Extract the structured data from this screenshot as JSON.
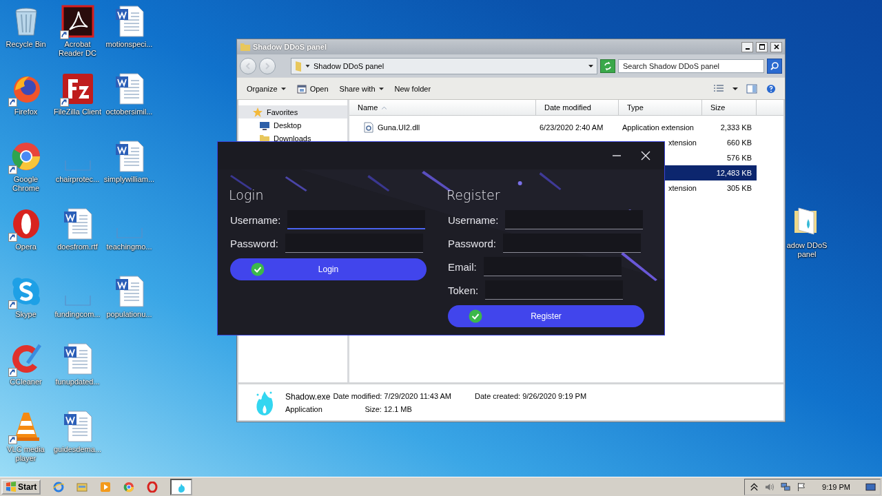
{
  "desktop": {
    "icon_columns": [
      [
        {
          "label": "Recycle Bin",
          "kind": "recycle",
          "shortcut": false
        },
        {
          "label": "Firefox",
          "kind": "firefox",
          "shortcut": true
        },
        {
          "label": "Google Chrome",
          "kind": "chrome",
          "shortcut": true
        },
        {
          "label": "Opera",
          "kind": "opera",
          "shortcut": true
        },
        {
          "label": "Skype",
          "kind": "skype",
          "shortcut": true
        },
        {
          "label": "CCleaner",
          "kind": "ccleaner",
          "shortcut": true
        },
        {
          "label": "VLC media player",
          "kind": "vlc",
          "shortcut": true
        }
      ],
      [
        {
          "label": "Acrobat Reader DC",
          "kind": "acrobat",
          "shortcut": true
        },
        {
          "label": "FileZilla Client",
          "kind": "filezilla",
          "shortcut": true
        },
        {
          "label": "chairprotec...",
          "kind": "blank",
          "shortcut": false
        },
        {
          "label": "doesfrom.rtf",
          "kind": "word",
          "shortcut": false
        },
        {
          "label": "fundingcom...",
          "kind": "blank",
          "shortcut": false
        },
        {
          "label": "funupdated...",
          "kind": "word",
          "shortcut": false
        },
        {
          "label": "guidesdema...",
          "kind": "word",
          "shortcut": false
        }
      ],
      [
        {
          "label": "motionspeci...",
          "kind": "word",
          "shortcut": false
        },
        {
          "label": "octobersimil...",
          "kind": "word",
          "shortcut": false
        },
        {
          "label": "simplywilliam...",
          "kind": "word",
          "shortcut": false
        },
        {
          "label": "teachingmo...",
          "kind": "blank",
          "shortcut": false
        },
        {
          "label": "populationu...",
          "kind": "word",
          "shortcut": false
        }
      ]
    ],
    "folder": {
      "label": "adow DDoS panel"
    }
  },
  "explorer": {
    "title": "Shadow DDoS panel",
    "address": "Shadow DDoS panel",
    "search_placeholder": "Search Shadow DDoS panel",
    "toolbar": [
      {
        "label": "Organize",
        "kind": "menu"
      },
      {
        "label": "Open",
        "kind": "open"
      },
      {
        "label": "Share with",
        "kind": "menu"
      },
      {
        "label": "New folder",
        "kind": "plain"
      }
    ],
    "nav": [
      {
        "label": "Favorites",
        "kind": "favorites",
        "selected": true
      },
      {
        "label": "Desktop",
        "kind": "desktop",
        "selected": false
      },
      {
        "label": "Downloads",
        "kind": "downloads",
        "selected": false
      }
    ],
    "columns": [
      {
        "label": "Name",
        "sorted": true
      },
      {
        "label": "Date modified",
        "sorted": false
      },
      {
        "label": "Type",
        "sorted": false
      },
      {
        "label": "Size",
        "sorted": false
      }
    ],
    "rows": [
      {
        "name": "Guna.UI2.dll",
        "date_modified": "6/23/2020 2:40 AM",
        "type": "Application extension",
        "size": "2,333 KB",
        "selected": false
      },
      {
        "type": "xtension",
        "size": "660 KB",
        "selected": false
      },
      {
        "size": "576 KB",
        "selected": false
      },
      {
        "size": "12,483 KB",
        "selected": true
      },
      {
        "type": "xtension",
        "size": "305 KB",
        "selected": false
      }
    ],
    "details": {
      "name": "Shadow.exe",
      "type": "Application",
      "date_modified": "Date modified: 7/29/2020 11:43 AM",
      "date_created": "Date created: 9/26/2020 9:19 PM",
      "size": "Size: 12.1 MB"
    }
  },
  "dialog": {
    "sections": [
      {
        "title": "Login",
        "fields": [
          {
            "label": "Username:",
            "focused": true
          },
          {
            "label": "Password:",
            "focused": false
          }
        ],
        "button": "Login"
      },
      {
        "title": "Register",
        "fields": [
          {
            "label": "Username:",
            "focused": false
          },
          {
            "label": "Password:",
            "focused": false
          },
          {
            "label": "Email:",
            "focused": false
          },
          {
            "label": "Token:",
            "focused": false
          }
        ],
        "button": "Register"
      }
    ]
  },
  "taskbar": {
    "start": "Start",
    "running": [
      {
        "selected": true
      }
    ],
    "clock": "9:19 PM"
  }
}
